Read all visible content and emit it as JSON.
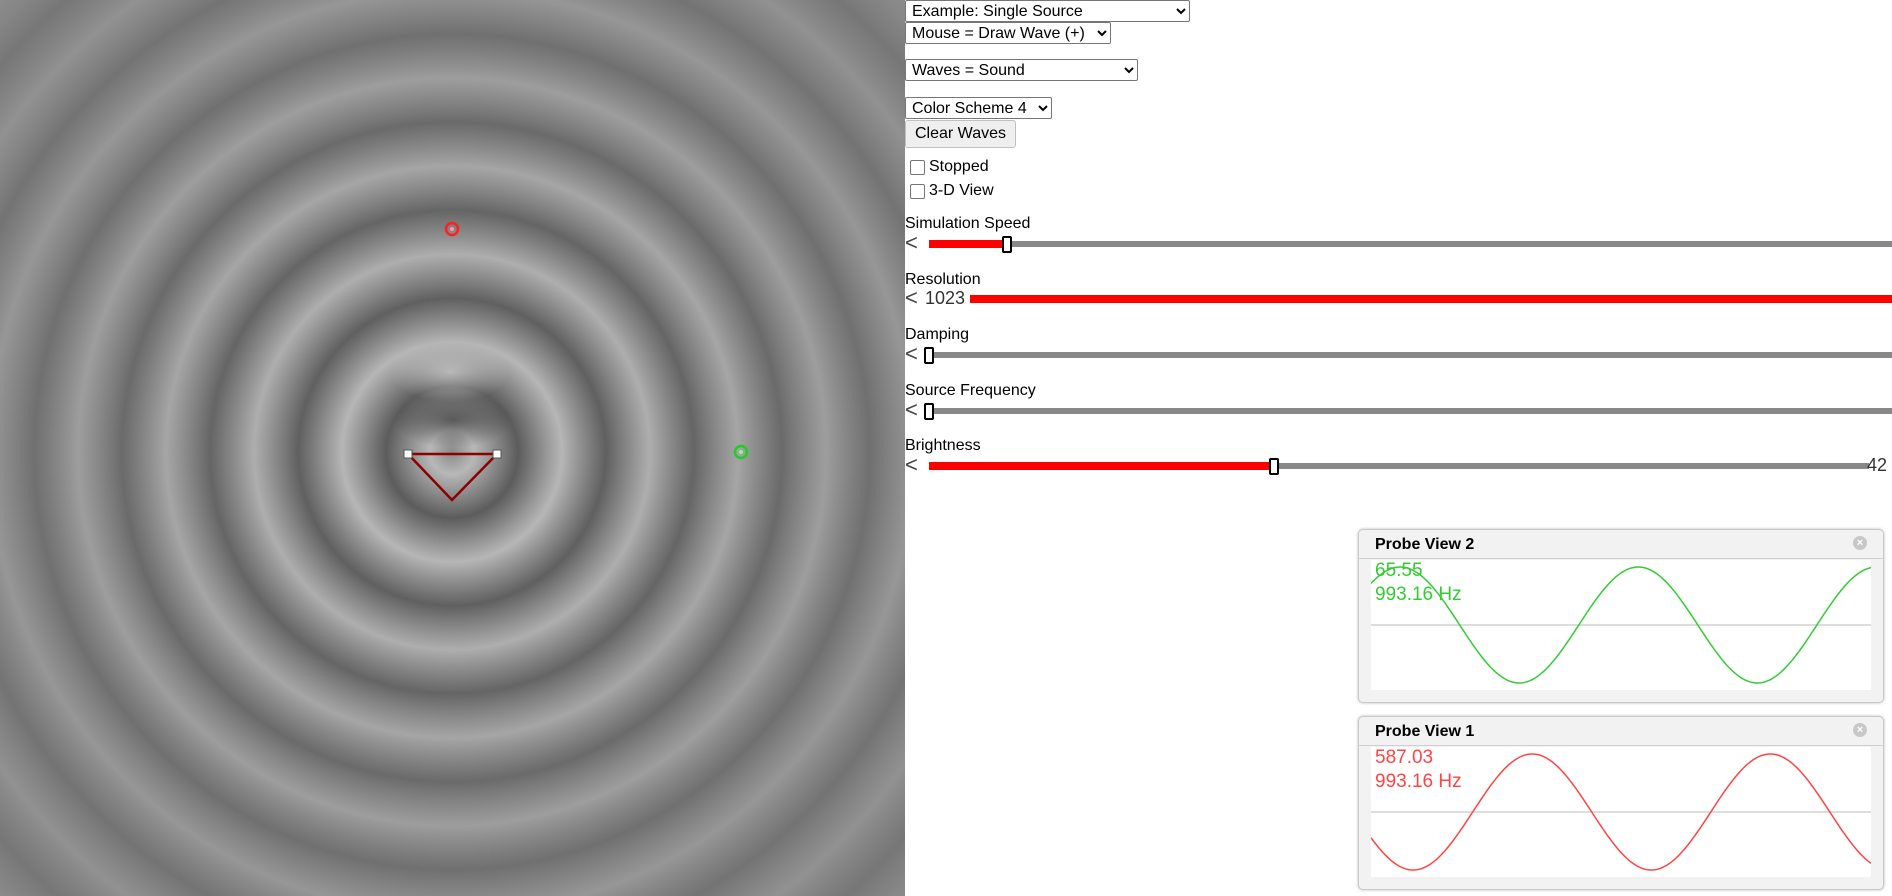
{
  "controls": {
    "example_select": "Example: Single Source",
    "mouse_select": "Mouse = Draw Wave (+)",
    "waves_select": "Waves = Sound",
    "color_select": "Color Scheme 4",
    "clear_button": "Clear Waves",
    "stopped_label": "Stopped",
    "view3d_label": "3-D View"
  },
  "sliders": [
    {
      "label": "Simulation Speed",
      "fraction": 0.08
    },
    {
      "label": "Resolution",
      "value_text": "1023",
      "fraction": 1.0
    },
    {
      "label": "Damping",
      "fraction": 0.0
    },
    {
      "label": "Source Frequency",
      "fraction": 0.0
    },
    {
      "label": "Brightness",
      "value_text": "42",
      "fraction": 0.37
    }
  ],
  "probes": [
    {
      "title": "Probe View 2",
      "value": "65.55",
      "frequency": "993.16 Hz",
      "color": "#33cc33",
      "phase": 0.8
    },
    {
      "title": "Probe View 1",
      "value": "587.03",
      "frequency": "993.16 Hz",
      "color": "#ff4444",
      "phase": 3.6
    }
  ],
  "colors": {
    "accent": "#ff0000",
    "probe_green": "#33cc33",
    "probe_red": "#ff4444"
  }
}
